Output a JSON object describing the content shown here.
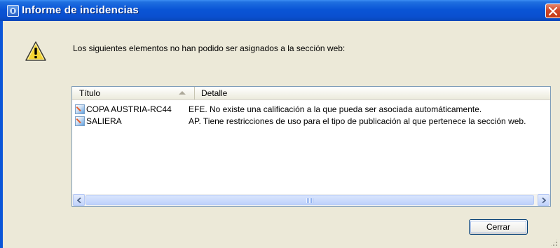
{
  "window": {
    "title": "Informe de incidencias",
    "icon": "app-icon",
    "close_icon": "close-icon",
    "accent_color": "#0a55d6",
    "close_color": "#d0482a"
  },
  "dialog": {
    "icon": "warning-icon",
    "message": "Los siguientes elementos no han podido ser asignados a la sección web:"
  },
  "listview": {
    "columns": [
      {
        "label": "Título",
        "sort": "ascending"
      },
      {
        "label": "Detalle"
      }
    ],
    "rows": [
      {
        "icon": "item-icon",
        "titulo": "COPA AUSTRIA-RC44",
        "detalle": "EFE. No existe una calificación a la que pueda ser asociada automáticamente."
      },
      {
        "icon": "item-icon",
        "titulo": "SALIERA",
        "detalle": "AP. Tiene restricciones de uso para el tipo de publicación al que pertenece la sección web."
      }
    ],
    "scrollbar_icons": [
      "chevron-left-icon",
      "chevron-right-icon"
    ]
  },
  "buttons": {
    "close_label": "Cerrar"
  }
}
